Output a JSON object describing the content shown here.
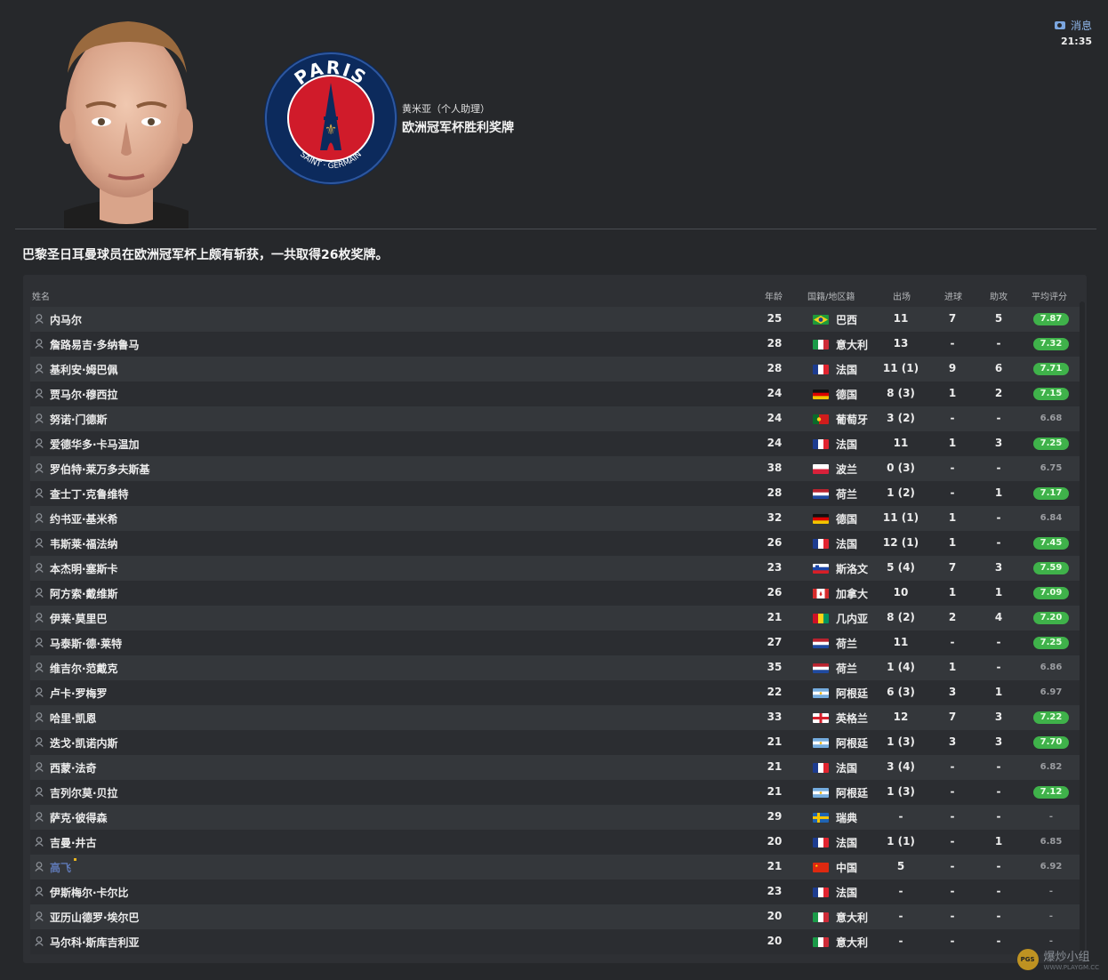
{
  "header": {
    "message_label": "消息",
    "time": "21:35",
    "byline": "黄米亚（个人助理）",
    "title": "欧洲冠军杯胜利奖牌",
    "club_badge": {
      "top_text": "PARIS",
      "bottom_text": "SAINT · GERMAIN",
      "colors": {
        "ring": "#0c2a5c",
        "red": "#d01b2a",
        "gold": "#c8a046"
      }
    }
  },
  "news_text": "巴黎圣日耳曼球员在欧洲冠军杯上颇有斩获，一共取得26枚奖牌。",
  "table": {
    "columns": {
      "name": "姓名",
      "age": "年龄",
      "nation": "国籍/地区籍",
      "apps": "出场",
      "goals": "进球",
      "assists": "助攻",
      "rating": "平均评分"
    },
    "rows": [
      {
        "name": "内马尔",
        "age": "25",
        "flag": "brazil",
        "nation": "巴西",
        "apps": "11",
        "goals": "7",
        "assists": "5",
        "rating": "7.87",
        "good": true
      },
      {
        "name": "詹路易吉·多纳鲁马",
        "age": "28",
        "flag": "italy",
        "nation": "意大利",
        "apps": "13",
        "goals": "-",
        "assists": "-",
        "rating": "7.32",
        "good": true
      },
      {
        "name": "基利安·姆巴佩",
        "age": "28",
        "flag": "france",
        "nation": "法国",
        "apps": "11 (1)",
        "goals": "9",
        "assists": "6",
        "rating": "7.71",
        "good": true
      },
      {
        "name": "贾马尔·穆西拉",
        "age": "24",
        "flag": "germany",
        "nation": "德国",
        "apps": "8 (3)",
        "goals": "1",
        "assists": "2",
        "rating": "7.15",
        "good": true
      },
      {
        "name": "努诺·门德斯",
        "age": "24",
        "flag": "portugal",
        "nation": "葡萄牙",
        "apps": "3 (2)",
        "goals": "-",
        "assists": "-",
        "rating": "6.68",
        "good": false
      },
      {
        "name": "爱德华多·卡马温加",
        "age": "24",
        "flag": "france",
        "nation": "法国",
        "apps": "11",
        "goals": "1",
        "assists": "3",
        "rating": "7.25",
        "good": true
      },
      {
        "name": "罗伯特·莱万多夫斯基",
        "age": "38",
        "flag": "poland",
        "nation": "波兰",
        "apps": "0 (3)",
        "goals": "-",
        "assists": "-",
        "rating": "6.75",
        "good": false
      },
      {
        "name": "查士丁·克鲁维特",
        "age": "28",
        "flag": "netherlands",
        "nation": "荷兰",
        "apps": "1 (2)",
        "goals": "-",
        "assists": "1",
        "rating": "7.17",
        "good": true
      },
      {
        "name": "约书亚·基米希",
        "age": "32",
        "flag": "germany",
        "nation": "德国",
        "apps": "11 (1)",
        "goals": "1",
        "assists": "-",
        "rating": "6.84",
        "good": false
      },
      {
        "name": "韦斯莱·福法纳",
        "age": "26",
        "flag": "france",
        "nation": "法国",
        "apps": "12 (1)",
        "goals": "1",
        "assists": "-",
        "rating": "7.45",
        "good": true
      },
      {
        "name": "本杰明·塞斯卡",
        "age": "23",
        "flag": "slovenia",
        "nation": "斯洛文",
        "apps": "5 (4)",
        "goals": "7",
        "assists": "3",
        "rating": "7.59",
        "good": true
      },
      {
        "name": "阿方索·戴维斯",
        "age": "26",
        "flag": "canada",
        "nation": "加拿大",
        "apps": "10",
        "goals": "1",
        "assists": "1",
        "rating": "7.09",
        "good": true
      },
      {
        "name": "伊莱·莫里巴",
        "age": "21",
        "flag": "guinea",
        "nation": "几内亚",
        "apps": "8 (2)",
        "goals": "2",
        "assists": "4",
        "rating": "7.20",
        "good": true
      },
      {
        "name": "马泰斯·德·莱特",
        "age": "27",
        "flag": "netherlands",
        "nation": "荷兰",
        "apps": "11",
        "goals": "-",
        "assists": "-",
        "rating": "7.25",
        "good": true
      },
      {
        "name": "维吉尔·范戴克",
        "age": "35",
        "flag": "netherlands",
        "nation": "荷兰",
        "apps": "1 (4)",
        "goals": "1",
        "assists": "-",
        "rating": "6.86",
        "good": false
      },
      {
        "name": "卢卡·罗梅罗",
        "age": "22",
        "flag": "argentina",
        "nation": "阿根廷",
        "apps": "6 (3)",
        "goals": "3",
        "assists": "1",
        "rating": "6.97",
        "good": false
      },
      {
        "name": "哈里·凯恩",
        "age": "33",
        "flag": "england",
        "nation": "英格兰",
        "apps": "12",
        "goals": "7",
        "assists": "3",
        "rating": "7.22",
        "good": true
      },
      {
        "name": "迭戈·凯诺内斯",
        "age": "21",
        "flag": "argentina",
        "nation": "阿根廷",
        "apps": "1 (3)",
        "goals": "3",
        "assists": "3",
        "rating": "7.70",
        "good": true
      },
      {
        "name": "西蒙·法奇",
        "age": "21",
        "flag": "france",
        "nation": "法国",
        "apps": "3 (4)",
        "goals": "-",
        "assists": "-",
        "rating": "6.82",
        "good": false
      },
      {
        "name": "吉列尔莫·贝拉",
        "age": "21",
        "flag": "argentina",
        "nation": "阿根廷",
        "apps": "1 (3)",
        "goals": "-",
        "assists": "-",
        "rating": "7.12",
        "good": true
      },
      {
        "name": "萨克·彼得森",
        "age": "29",
        "flag": "sweden",
        "nation": "瑞典",
        "apps": "-",
        "goals": "-",
        "assists": "-",
        "rating": "-",
        "good": false
      },
      {
        "name": "吉曼·井古",
        "age": "20",
        "flag": "france",
        "nation": "法国",
        "apps": "1 (1)",
        "goals": "-",
        "assists": "1",
        "rating": "6.85",
        "good": false
      },
      {
        "name": "高飞",
        "age": "21",
        "flag": "china",
        "nation": "中国",
        "apps": "5",
        "goals": "-",
        "assists": "-",
        "rating": "6.92",
        "good": false,
        "highlight": true
      },
      {
        "name": "伊斯梅尔·卡尔比",
        "age": "23",
        "flag": "france",
        "nation": "法国",
        "apps": "-",
        "goals": "-",
        "assists": "-",
        "rating": "-",
        "good": false
      },
      {
        "name": "亚历山德罗·埃尔巴",
        "age": "20",
        "flag": "italy",
        "nation": "意大利",
        "apps": "-",
        "goals": "-",
        "assists": "-",
        "rating": "-",
        "good": false
      },
      {
        "name": "马尔科·斯库吉利亚",
        "age": "20",
        "flag": "italy",
        "nation": "意大利",
        "apps": "-",
        "goals": "-",
        "assists": "-",
        "rating": "-",
        "good": false
      }
    ]
  },
  "watermark": {
    "logo": "PGS",
    "text": "爆炒小组",
    "url": "WWW.PLAYGM.CC"
  },
  "colors": {
    "good_rating": "#3fb24a",
    "highlight_name": "#5f79b6"
  }
}
